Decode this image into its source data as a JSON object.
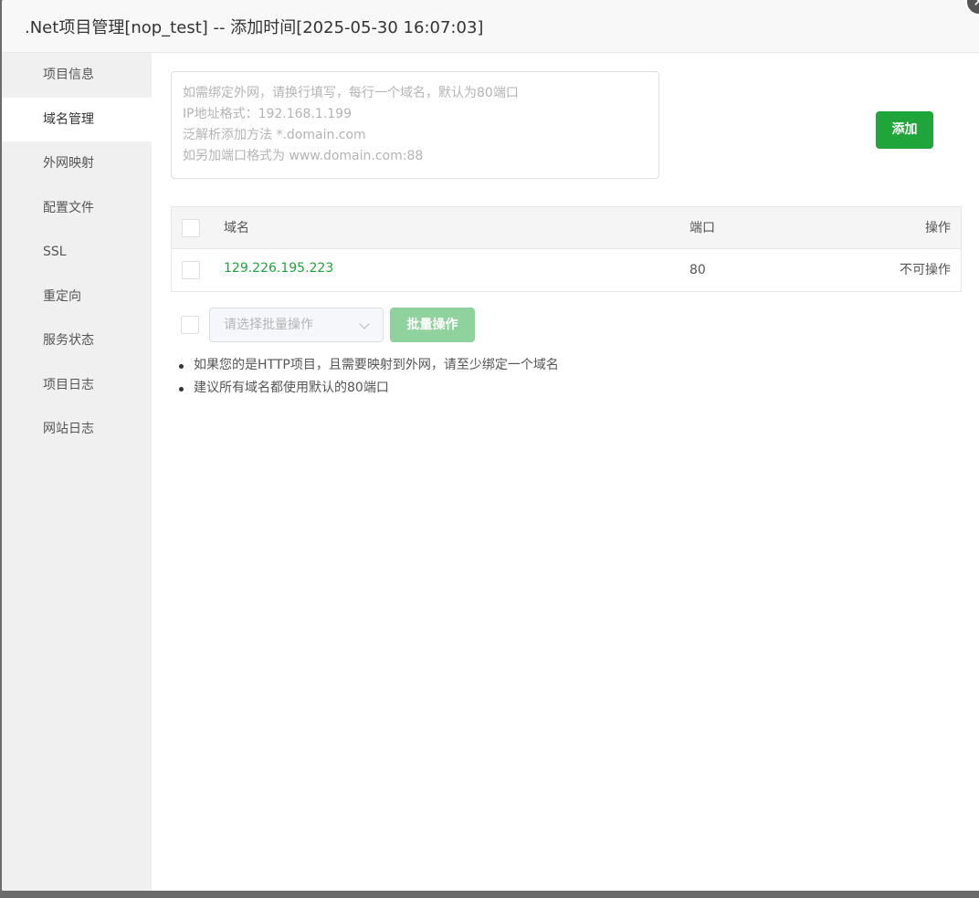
{
  "dialog": {
    "title": ".Net项目管理[nop_test] -- 添加时间[2025-05-30 16:07:03]",
    "close_icon": "close-icon"
  },
  "sidebar": {
    "items": [
      {
        "label": "项目信息"
      },
      {
        "label": "域名管理"
      },
      {
        "label": "外网映射"
      },
      {
        "label": "配置文件"
      },
      {
        "label": "SSL"
      },
      {
        "label": "重定向"
      },
      {
        "label": "服务状态"
      },
      {
        "label": "项目日志"
      },
      {
        "label": "网站日志"
      }
    ],
    "active": "域名管理"
  },
  "domain_input": {
    "placeholder": "如需绑定外网，请换行填写，每行一个域名，默认为80端口\nIP地址格式：192.168.1.199\n泛解析添加方法 *.domain.com\n如另加端口格式为 www.domain.com:88",
    "value": ""
  },
  "add_button": {
    "label": "添加"
  },
  "table": {
    "headers": {
      "domain": "域名",
      "port": "端口",
      "operation": "操作"
    },
    "rows": [
      {
        "domain": "129.226.195.223",
        "port": "80",
        "operation": "不可操作"
      }
    ]
  },
  "batch": {
    "select_placeholder": "请选择批量操作",
    "button_label": "批量操作"
  },
  "tips": [
    "如果您的是HTTP项目，且需要映射到外网，请至少绑定一个域名",
    "建议所有域名都使用默认的80端口"
  ],
  "colors": {
    "accent": "#20a53a",
    "accent_disabled": "#90d29d"
  }
}
